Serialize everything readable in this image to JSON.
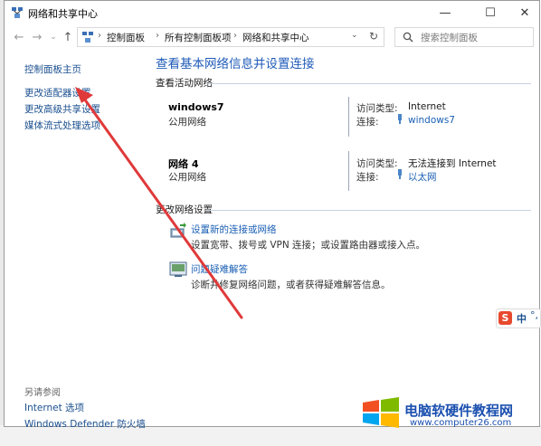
{
  "window": {
    "title": "网络和共享中心"
  },
  "nav": {
    "breadcrumb": [
      "控制面板",
      "所有控制面板项",
      "网络和共享中心"
    ],
    "search_placeholder": "搜索控制面板"
  },
  "sidebar": {
    "items": [
      {
        "label": "控制面板主页"
      },
      {
        "label": "更改适配器设置"
      },
      {
        "label": "更改高级共享设置"
      },
      {
        "label": "媒体流式处理选项"
      }
    ],
    "see_also_title": "另请参阅",
    "see_also": [
      {
        "label": "Internet 选项"
      },
      {
        "label": "Windows Defender 防火墙"
      }
    ]
  },
  "main": {
    "title": "查看基本网络信息并设置连接",
    "active_networks_label": "查看活动网络",
    "access_type_label": "访问类型:",
    "connection_label": "连接:",
    "networks": [
      {
        "name": "windows7",
        "category": "公用网络",
        "access_type": "Internet",
        "connection": "windows7"
      },
      {
        "name": "网络 4",
        "category": "公用网络",
        "access_type": "无法连接到 Internet",
        "connection": "以太网"
      }
    ],
    "change_settings_label": "更改网络设置",
    "tasks": [
      {
        "title": "设置新的连接或网络",
        "desc": "设置宽带、拨号或 VPN 连接；或设置路由器或接入点。"
      },
      {
        "title": "问题疑难解答",
        "desc": "诊断并修复网络问题，或者获得疑难解答信息。"
      }
    ]
  },
  "ime": {
    "label": "中"
  },
  "watermark": {
    "title": "电脑软硬件教程网",
    "url": "www.computer26.com"
  },
  "colors": {
    "link": "#1a4f8f",
    "heading": "#1f5bb8",
    "arrow": "#e0393a"
  }
}
